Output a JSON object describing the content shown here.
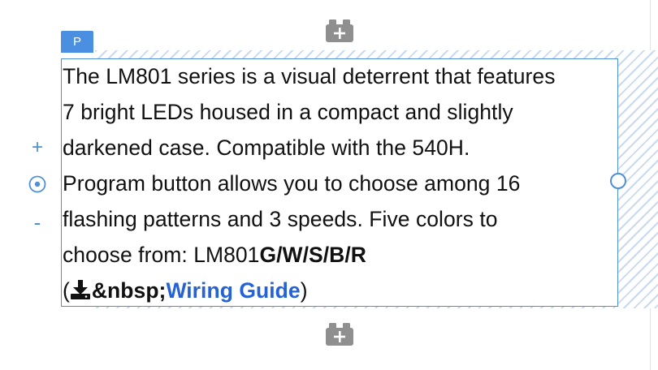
{
  "tag": {
    "label": "P"
  },
  "controls": {
    "plus": "+",
    "minus": "-"
  },
  "paragraph": {
    "line1": "The LM801 series is a visual deterrent that features",
    "line2": "7 bright LEDs housed in a compact and slightly",
    "line3": "darkened case. Compatible with the 540H.",
    "line4": "Program button allows you to choose among 16",
    "line5": "flashing patterns and 3 speeds. Five colors to",
    "line6_prefix": "choose from: LM801",
    "line6_bold": "G/W/S/B/R",
    "line7_open": "(",
    "line7_nbsp": "&nbsp;",
    "line7_link": "Wiring Guide",
    "line7_close": ")"
  },
  "colors": {
    "accent": "#4f8fd8",
    "tag": "#4a8fe0",
    "link": "#2462d6",
    "addBlock": "#8f8f8f"
  },
  "icons": {
    "add_block": "add-block-icon",
    "download": "download-icon",
    "target": "target-icon"
  }
}
